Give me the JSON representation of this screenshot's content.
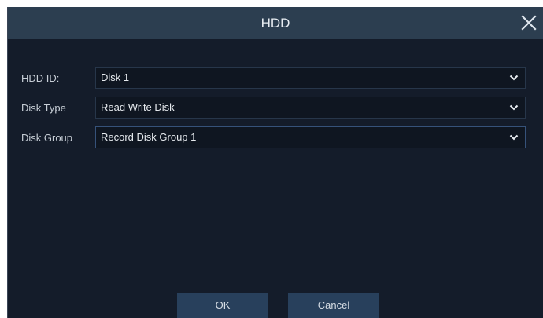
{
  "dialog": {
    "title": "HDD",
    "close_icon": "close-icon"
  },
  "fields": [
    {
      "label": "HDD ID:",
      "value": "Disk 1",
      "icon": "chevron-down-icon"
    },
    {
      "label": "Disk Type",
      "value": "Read Write Disk",
      "icon": "chevron-down-icon"
    },
    {
      "label": "Disk Group",
      "value": "Record Disk Group 1",
      "icon": "chevron-down-icon"
    }
  ],
  "buttons": {
    "ok_label": "OK",
    "cancel_label": "Cancel"
  },
  "colors": {
    "titlebar": "#2c3e50",
    "background": "#141c2a",
    "button": "#28405c"
  }
}
